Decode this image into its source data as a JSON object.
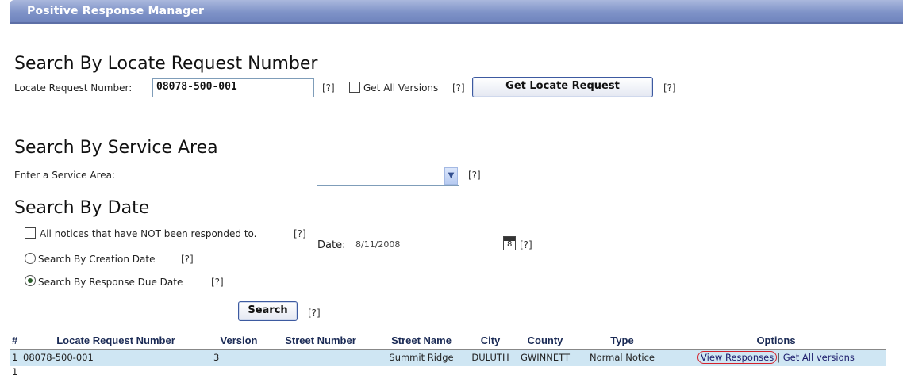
{
  "app": {
    "title": "Positive Response Manager"
  },
  "locate_search": {
    "heading": "Search By Locate Request Number",
    "field_label": "Locate Request Number:",
    "field_value": "08078-500-001",
    "help": "[?]",
    "all_versions_label": "Get All Versions",
    "all_versions_checked": false,
    "help2": "[?]",
    "button_label": "Get Locate Request",
    "help3": "[?]"
  },
  "service_area": {
    "heading": "Search By Service Area",
    "field_label": "Enter a Service Area:",
    "selected_value": "",
    "help": "[?]"
  },
  "date_search": {
    "heading": "Search By Date",
    "not_responded_label": "All notices that have NOT been responded to.",
    "not_responded_checked": false,
    "help1": "[?]",
    "date_label": "Date:",
    "date_value": "8/11/2008",
    "calendar_icon": "calendar-icon",
    "help_date": "[?]",
    "radio_creation_label": "Search By Creation Date",
    "help_creation": "[?]",
    "radio_due_label": "Search By Response Due Date",
    "help_due": "[?]",
    "selected_radio": "response_due_date",
    "search_button": "Search",
    "help_search": "[?]"
  },
  "results": {
    "columns": [
      "#",
      "Locate Request Number",
      "Version",
      "Street Number",
      "Street Name",
      "City",
      "County",
      "Type",
      "Options"
    ],
    "rows": [
      {
        "num": "1",
        "locate_request_number": "08078-500-001",
        "version": "3",
        "street_number": "",
        "street_name": "Summit Ridge",
        "city": "DULUTH",
        "county": "GWINNETT",
        "type": "Normal Notice",
        "option_view": "View Responses",
        "option_separator": "|",
        "option_all": "Get All versions"
      }
    ],
    "footer": "1"
  },
  "colors": {
    "title_bar": "#7f93c8",
    "row_highlight": "#cfe6f3",
    "circle_annotation": "#d4212b"
  }
}
